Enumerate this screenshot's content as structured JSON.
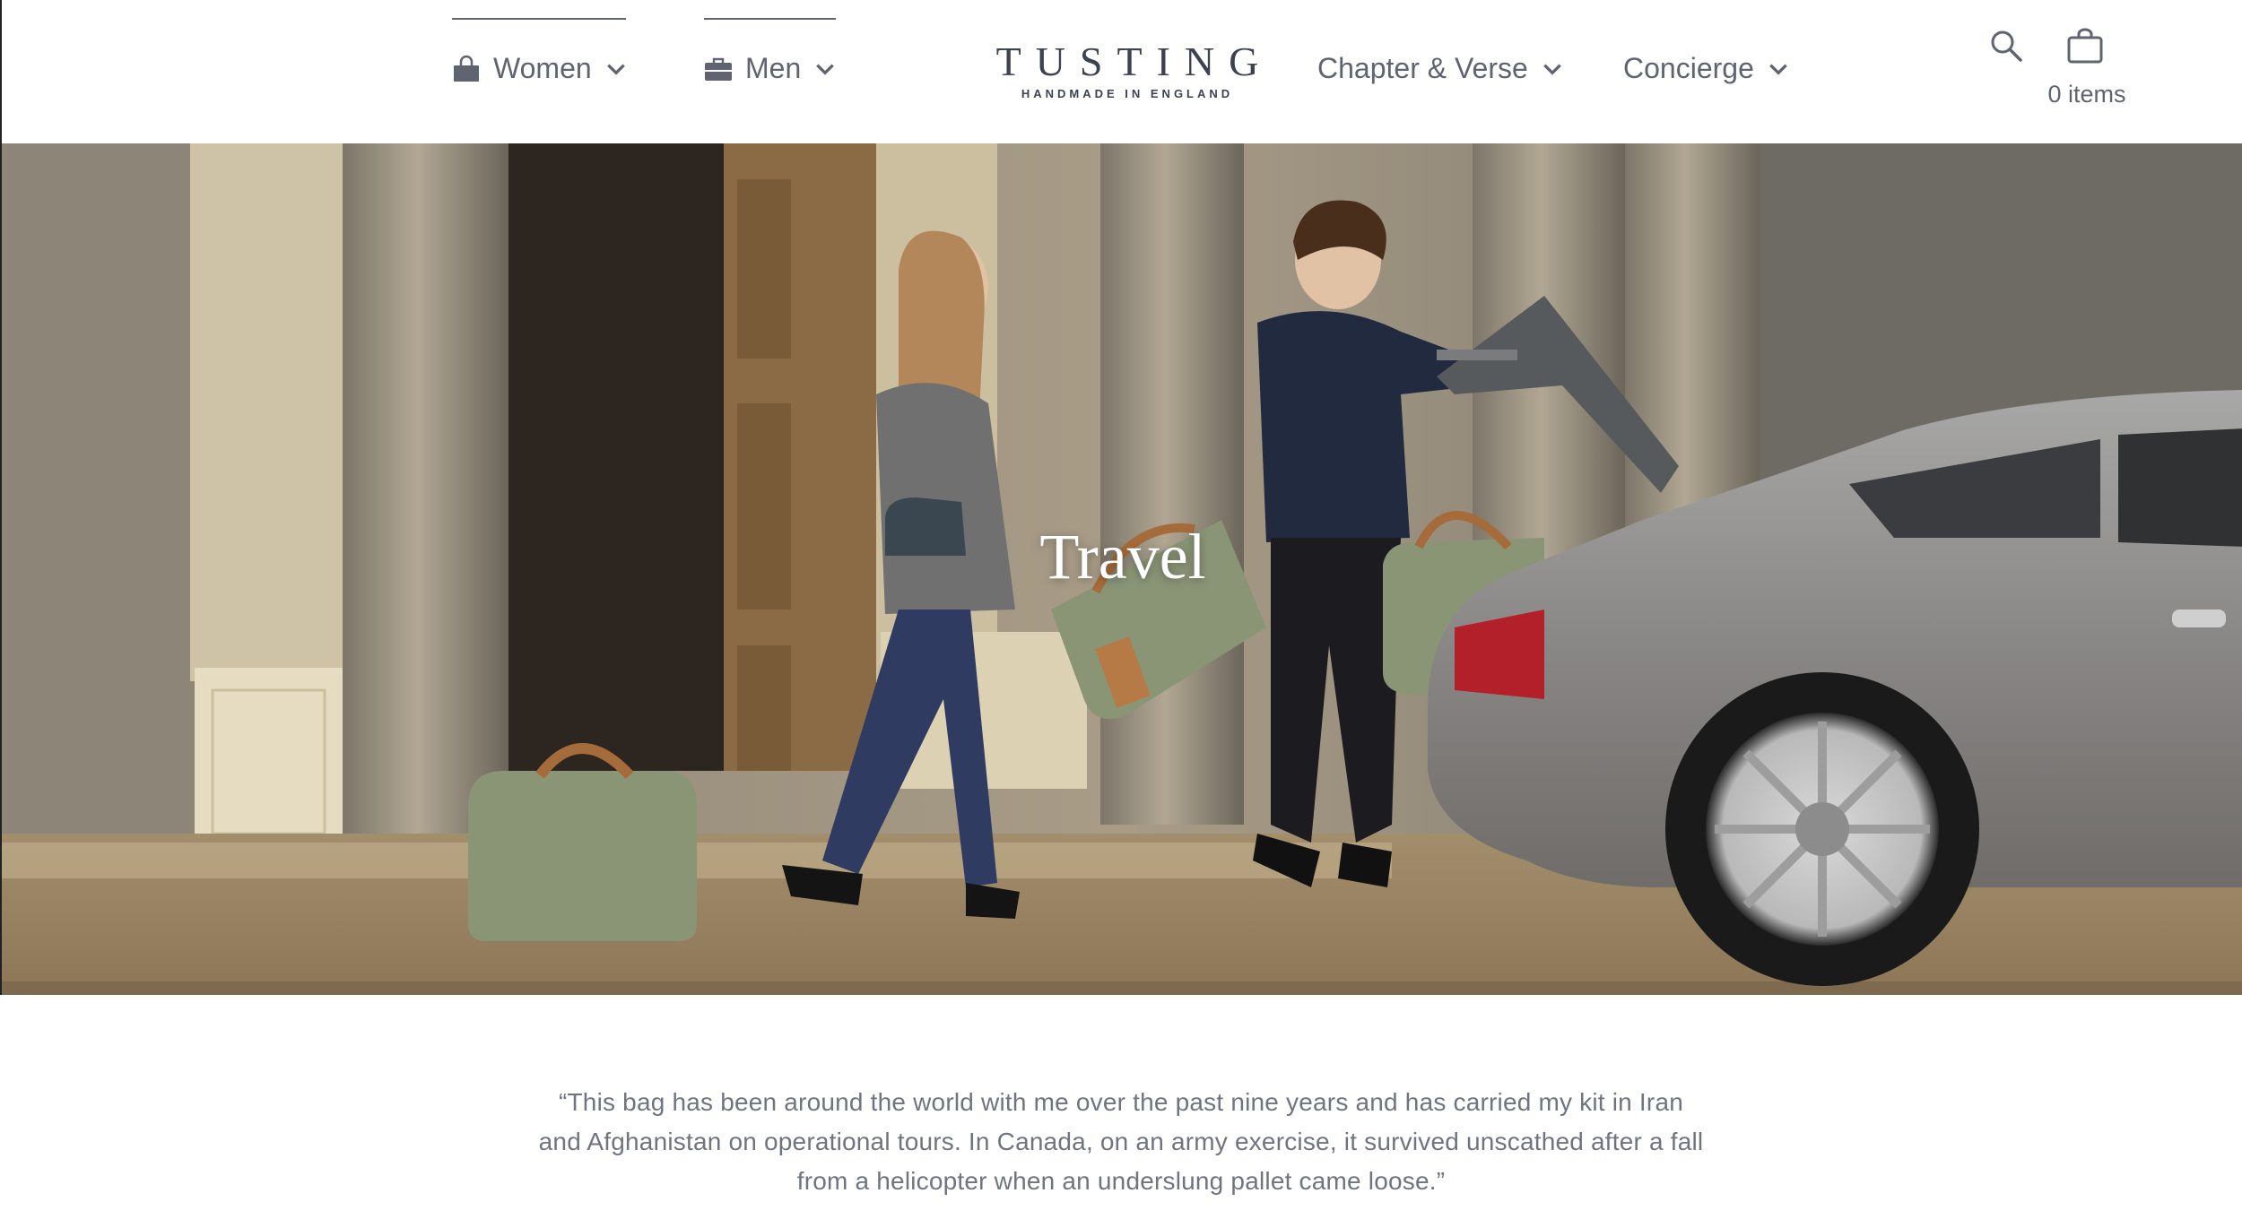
{
  "nav": {
    "women_label": "Women",
    "men_label": "Men",
    "chapter_label": "Chapter & Verse",
    "concierge_label": "Concierge"
  },
  "brand": {
    "name": "TUSTING",
    "tagline": "HANDMADE IN ENGLAND"
  },
  "cart": {
    "count_label": "0 items"
  },
  "hero": {
    "title": "Travel"
  },
  "testimonial": {
    "quote": "“This bag has been around the world with me over the past nine years and has carried my kit in Iran and Afghanistan on operational tours. In Canada, on an army exercise, it survived unscathed after a fall from a helicopter when an underslung pallet came loose.”"
  },
  "icons": {
    "women": "handbag-icon",
    "men": "briefcase-icon",
    "search": "search-icon",
    "cart": "shopping-bag-icon",
    "dropdown": "chevron-down-icon"
  },
  "colors": {
    "text": "#5f6470",
    "logo": "#3d4250",
    "background": "#ffffff"
  }
}
